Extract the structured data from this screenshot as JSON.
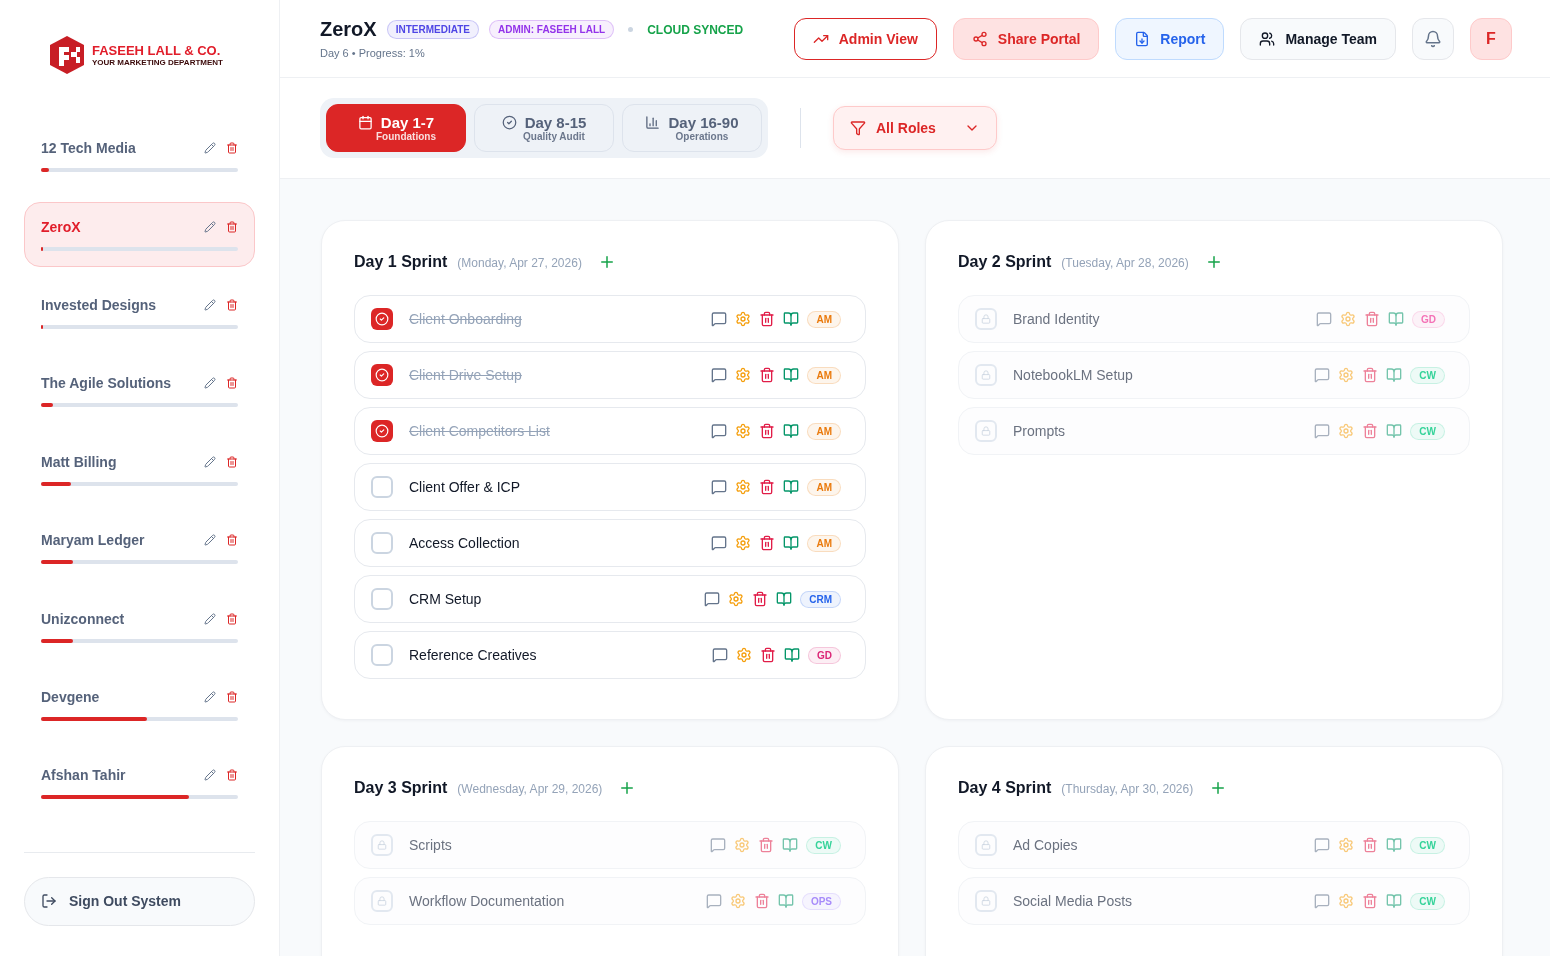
{
  "brand": {
    "name": "FASEEH LALL & CO.",
    "tagline": "YOUR MARKETING DEPARTMENT"
  },
  "clients": [
    {
      "name": "12 Tech Media",
      "level": 0.04,
      "selected": false
    },
    {
      "name": "ZeroX",
      "level": 0.01,
      "selected": true
    },
    {
      "name": "Invested Designs",
      "level": 0.01,
      "selected": false
    },
    {
      "name": "The Agile Solutions",
      "level": 0.06,
      "selected": false
    },
    {
      "name": "Matt Billing",
      "level": 0.15,
      "selected": false
    },
    {
      "name": "Maryam Ledger",
      "level": 0.16,
      "selected": false
    },
    {
      "name": "Unizconnect",
      "level": 0.16,
      "selected": false
    },
    {
      "name": "Devgene",
      "level": 0.54,
      "selected": false
    },
    {
      "name": "Afshan Tahir",
      "level": 0.75,
      "selected": false
    }
  ],
  "sign_out": "Sign Out System",
  "header": {
    "title": "ZeroX",
    "badges": [
      {
        "label": "INTERMEDIATE",
        "color": "#4f46e5"
      },
      {
        "label": "ADMIN: FASEEH LALL",
        "color": "#9333ea"
      }
    ],
    "sync": "CLOUD SYNCED",
    "subtitle": "Day 6 • Progress: 1%",
    "buttons": [
      {
        "label": "Admin View",
        "kind": "outline"
      },
      {
        "label": "Share Portal",
        "kind": "soft"
      },
      {
        "label": "Report",
        "kind": "info"
      },
      {
        "label": "Manage Team",
        "kind": "plain"
      }
    ],
    "avatar": "F"
  },
  "phases": [
    {
      "label": "Day 1-7",
      "sub": "Foundations",
      "selected": true
    },
    {
      "label": "Day 8-15",
      "sub": "Quality Audit",
      "selected": false
    },
    {
      "label": "Day 16-90",
      "sub": "Operations",
      "selected": false
    }
  ],
  "role_filter": "All Roles",
  "sprints": [
    {
      "title": "Day 1 Sprint",
      "date": "(Monday, Apr 27, 2026)",
      "tasks": [
        {
          "name": "Client Onboarding",
          "checked": true,
          "locked": false,
          "tag": "AM",
          "color": "#ea7a0c"
        },
        {
          "name": "Client Drive Setup",
          "checked": true,
          "locked": false,
          "tag": "AM",
          "color": "#ea7a0c"
        },
        {
          "name": "Client Competitors List",
          "checked": true,
          "locked": false,
          "tag": "AM",
          "color": "#ea7a0c"
        },
        {
          "name": "Client Offer & ICP",
          "checked": false,
          "locked": false,
          "tag": "AM",
          "color": "#ea7a0c"
        },
        {
          "name": "Access Collection",
          "checked": false,
          "locked": false,
          "tag": "AM",
          "color": "#ea7a0c"
        },
        {
          "name": "CRM Setup",
          "checked": false,
          "locked": false,
          "tag": "CRM",
          "color": "#2563eb"
        },
        {
          "name": "Reference Creatives",
          "checked": false,
          "locked": false,
          "tag": "GD",
          "color": "#db2777"
        }
      ]
    },
    {
      "title": "Day 2 Sprint",
      "date": "(Tuesday, Apr 28, 2026)",
      "tasks": [
        {
          "name": "Brand Identity",
          "checked": false,
          "locked": true,
          "tag": "GD",
          "color": "#f472b6"
        },
        {
          "name": "NotebookLM Setup",
          "checked": false,
          "locked": true,
          "tag": "CW",
          "color": "#34d399"
        },
        {
          "name": "Prompts",
          "checked": false,
          "locked": true,
          "tag": "CW",
          "color": "#34d399"
        }
      ]
    },
    {
      "title": "Day 3 Sprint",
      "date": "(Wednesday, Apr 29, 2026)",
      "tasks": [
        {
          "name": "Scripts",
          "checked": false,
          "locked": true,
          "tag": "CW",
          "color": "#34d399"
        },
        {
          "name": "Workflow Documentation",
          "checked": false,
          "locked": true,
          "tag": "OPS",
          "color": "#a78bfa"
        }
      ]
    },
    {
      "title": "Day 4 Sprint",
      "date": "(Thursday, Apr 30, 2026)",
      "tasks": [
        {
          "name": "Ad Copies",
          "checked": false,
          "locked": true,
          "tag": "CW",
          "color": "#34d399"
        },
        {
          "name": "Social Media Posts",
          "checked": false,
          "locked": true,
          "tag": "CW",
          "color": "#34d399"
        }
      ]
    }
  ]
}
